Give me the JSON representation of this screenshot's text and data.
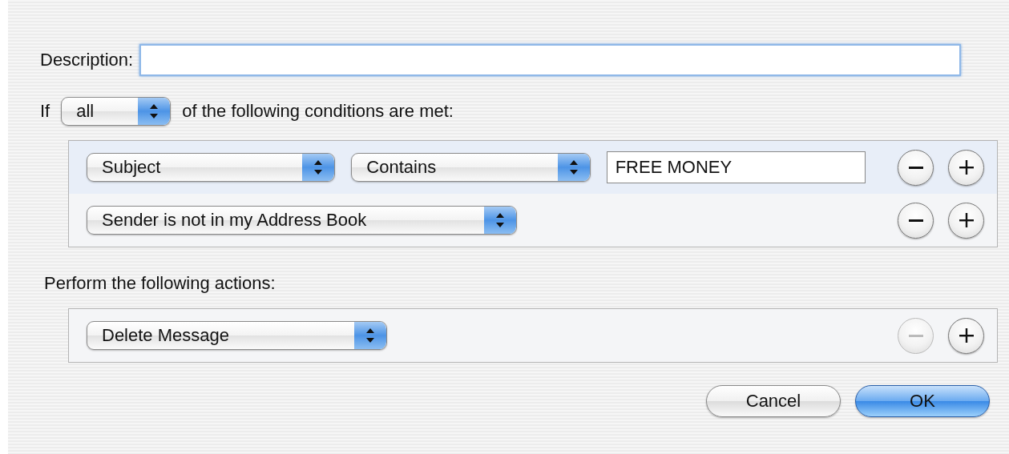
{
  "sheet": {
    "description": {
      "label": "Description:"
    },
    "match": {
      "prefix": "If",
      "popup": "all",
      "suffix": "of the following conditions are met:"
    },
    "conditions": [
      {
        "kind": "text",
        "selected": true,
        "field": "Subject",
        "operator": "Contains",
        "value": "FREE MONEY",
        "remove_disabled": false
      },
      {
        "kind": "simple",
        "selected": false,
        "field": "Sender is not in my Address Book",
        "remove_disabled": false
      }
    ],
    "actions_label": "Perform the following actions:",
    "actions": [
      {
        "action": "Delete Message",
        "selected": false,
        "remove_disabled": true
      }
    ],
    "buttons": [
      {
        "label": "Cancel",
        "default": false
      },
      {
        "label": "OK",
        "default": true
      }
    ]
  }
}
